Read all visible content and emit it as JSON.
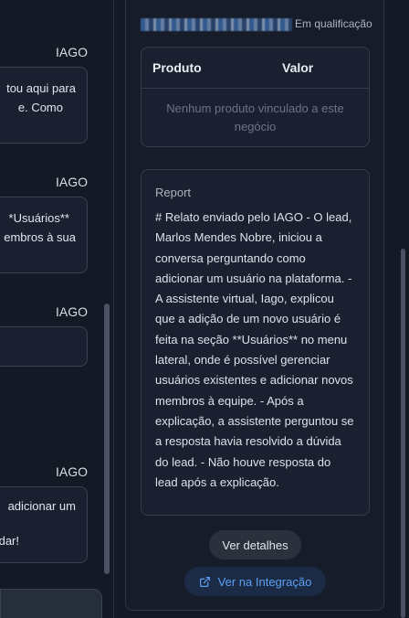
{
  "chat": {
    "messages": [
      {
        "sender": "IAGO",
        "lines": [
          "tou aqui para",
          "e. Como"
        ]
      },
      {
        "sender": "IAGO",
        "lines": [
          "*Usuários**",
          "embros à sua"
        ]
      },
      {
        "sender": "IAGO",
        "lines": [
          ""
        ]
      },
      {
        "sender": "IAGO",
        "lines": [
          "adicionar um",
          "",
          "dar!"
        ]
      }
    ]
  },
  "deal": {
    "stage": "Em qualificação"
  },
  "products": {
    "col_product": "Produto",
    "col_value": "Valor",
    "empty_text": "Nenhum produto vinculado a este negócio"
  },
  "report": {
    "label": "Report",
    "text": "# Relato enviado pelo IAGO - O lead, Marlos Mendes Nobre, iniciou a conversa perguntando como adicionar um usuário na plataforma. - A assistente virtual, Iago, explicou que a adição de um novo usuário é feita na seção **Usuários** no menu lateral, onde é possível gerenciar usuários existentes e adicionar novos membros à equipe. - Após a explicação, a assistente perguntou se a resposta havia resolvido a dúvida do lead. - Não houve resposta do lead após a explicação."
  },
  "actions": {
    "details_label": "Ver detalhes",
    "integration_label": "Ver na Integração"
  },
  "icons": {
    "integration": "external-link-icon"
  },
  "colors": {
    "accent": "#5d9ff2",
    "background": "#141926"
  }
}
